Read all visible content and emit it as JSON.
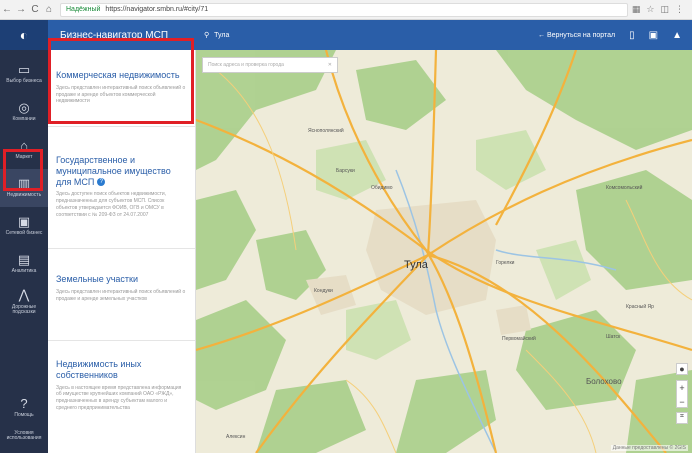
{
  "browser": {
    "nav": [
      "←",
      "→",
      "C",
      "⌂"
    ],
    "secure_label": "Надёжный",
    "url": "https://navigator.smbn.ru/#city/71",
    "toolbar_icons": [
      "qr-code-icon",
      "star-icon",
      "extension-icon",
      "menu-icon"
    ]
  },
  "header": {
    "logo": "logo-icon",
    "title": "Бизнес-навигатор МСП",
    "location": "Тула",
    "back_link": "← Вернуться на портал"
  },
  "sidebar": {
    "items": [
      {
        "label": "Выбор бизнеса",
        "icon": "briefcase-icon"
      },
      {
        "label": "Компании",
        "icon": "target-icon"
      },
      {
        "label": "Маркет",
        "icon": "market-icon"
      },
      {
        "label": "Недвижимость",
        "icon": "building-icon"
      },
      {
        "label": "Сетевой бизнес",
        "icon": "network-icon"
      },
      {
        "label": "Аналитика",
        "icon": "chart-icon"
      },
      {
        "label": "Дорожные подсказки",
        "icon": "road-icon"
      }
    ],
    "bottom": [
      {
        "label": "Помощь",
        "icon": "help-icon"
      },
      {
        "label": "Условия использования",
        "icon": ""
      }
    ]
  },
  "panel": {
    "cards": [
      {
        "title": "Коммерческая недвижимость",
        "description": "Здесь представлен интерактивный поиск объявлений о продаже и аренде объектов коммерческой недвижимости"
      },
      {
        "title": "Государственное и муниципальное имущество для МСП",
        "description": "Здесь доступен поиск объектов недвижимости, предназначенных для субъектов МСП. Список объектов утверждается ФОИВ, ОГВ и ОМСУ в соответствии с № 209-ФЗ от 24.07.2007"
      },
      {
        "title": "Земельные участки",
        "description": "Здесь представлен интерактивный поиск объявлений о продаже и аренде земельных участков"
      },
      {
        "title": "Недвижимость иных собственников",
        "description": "Здесь в настоящее время представлена информация об имуществе крупнейших компаний ОАО «РЖД», предназначенных в аренду субъектам малого и среднего предпринимательства"
      }
    ]
  },
  "map": {
    "search_placeholder": "Поиск адреса и проверка города",
    "city": "Тула",
    "places": [
      "Яснополянский",
      "Барсуки",
      "Обидимо",
      "Кондуки",
      "Болохово",
      "Шатск",
      "Алексин",
      "Первомайский",
      "Красный Яр",
      "Горелки",
      "Комсомольский"
    ],
    "attribution": "Данные предоставлены © 2GIS",
    "zoom_in": "+",
    "zoom_out": "−"
  }
}
